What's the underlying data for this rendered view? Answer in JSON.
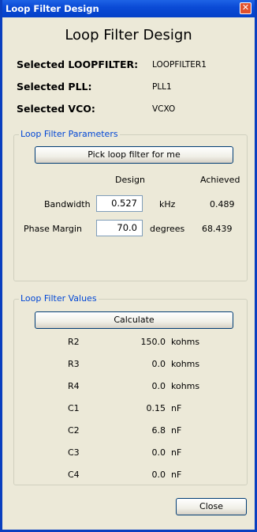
{
  "window": {
    "title": "Loop Filter Design",
    "close_glyph": "✕"
  },
  "heading": "Loop Filter Design",
  "info": [
    {
      "label": "Selected LOOPFILTER:",
      "value": "LOOPFILTER1"
    },
    {
      "label": "Selected PLL:",
      "value": "PLL1"
    },
    {
      "label": "Selected VCO:",
      "value": "VCXO"
    }
  ],
  "params": {
    "legend": "Loop Filter Parameters",
    "pick_button": "Pick loop filter for me",
    "col_design": "Design",
    "col_achieved": "Achieved",
    "rows": [
      {
        "label": "Bandwidth",
        "design": "0.527",
        "unit": "kHz",
        "achieved": "0.489"
      },
      {
        "label": "Phase Margin",
        "design": "70.0",
        "unit": "degrees",
        "achieved": "68.439"
      }
    ]
  },
  "values": {
    "legend": "Loop Filter Values",
    "calculate_button": "Calculate",
    "rows": [
      {
        "name": "R2",
        "value": "150.0",
        "unit": "kohms"
      },
      {
        "name": "R3",
        "value": "0.0",
        "unit": "kohms"
      },
      {
        "name": "R4",
        "value": "0.0",
        "unit": "kohms"
      },
      {
        "name": "C1",
        "value": "0.15",
        "unit": "nF"
      },
      {
        "name": "C2",
        "value": "6.8",
        "unit": "nF"
      },
      {
        "name": "C3",
        "value": "0.0",
        "unit": "nF"
      },
      {
        "name": "C4",
        "value": "0.0",
        "unit": "nF"
      }
    ]
  },
  "close_button": "Close",
  "colors": {
    "titlebar": "#0b4bd6",
    "dialog_bg": "#ece9d8",
    "group_legend": "#0046d5"
  }
}
